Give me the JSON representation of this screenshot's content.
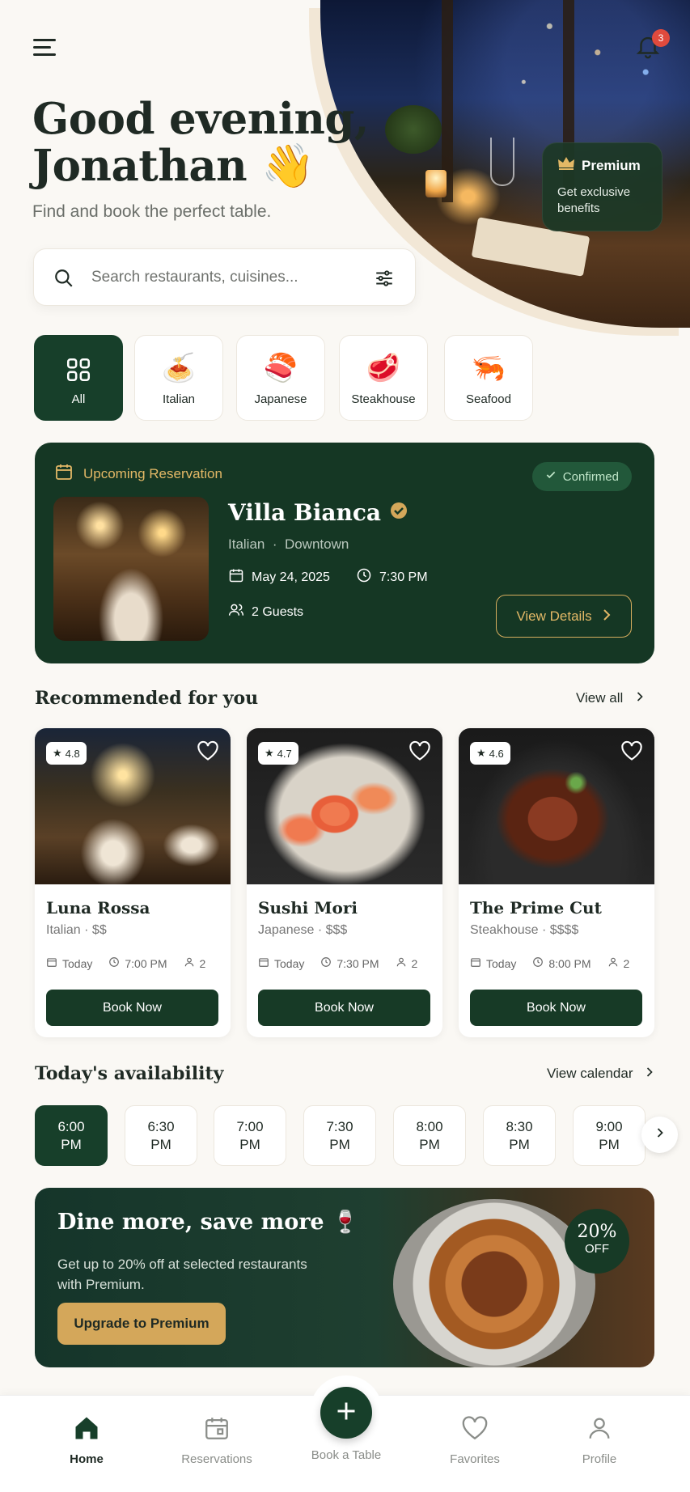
{
  "header": {
    "notification_count": "3",
    "greeting_line1": "Good evening,",
    "greeting_line2": "Jonathan 👋",
    "subtitle": "Find and book the perfect table."
  },
  "premium_card": {
    "title": "Premium",
    "desc": "Get exclusive benefits"
  },
  "search": {
    "placeholder": "Search restaurants, cuisines..."
  },
  "categories": [
    {
      "label": "All",
      "icon": "grid-icon"
    },
    {
      "label": "Italian",
      "icon": "🍝"
    },
    {
      "label": "Japanese",
      "icon": "🍣"
    },
    {
      "label": "Steakhouse",
      "icon": "🥩"
    },
    {
      "label": "Seafood",
      "icon": "🦐"
    }
  ],
  "reservation": {
    "heading": "Upcoming Reservation",
    "status": "Confirmed",
    "name": "Villa Bianca",
    "cuisine": "Italian",
    "area": "Downtown",
    "date": "May 24, 2025",
    "time": "7:30 PM",
    "guests": "2 Guests",
    "cta": "View Details"
  },
  "recommended": {
    "title": "Recommended for you",
    "link": "View all",
    "cards": [
      {
        "rating": "4.8",
        "name": "Luna Rossa",
        "cuisine": "Italian",
        "price": "$$",
        "day": "Today",
        "time": "7:00 PM",
        "guests": "2",
        "cta": "Book Now"
      },
      {
        "rating": "4.7",
        "name": "Sushi Mori",
        "cuisine": "Japanese",
        "price": "$$$",
        "day": "Today",
        "time": "7:30 PM",
        "guests": "2",
        "cta": "Book Now"
      },
      {
        "rating": "4.6",
        "name": "The Prime Cut",
        "cuisine": "Steakhouse",
        "price": "$$$$",
        "day": "Today",
        "time": "8:00 PM",
        "guests": "2",
        "cta": "Book Now"
      }
    ]
  },
  "availability": {
    "title": "Today's availability",
    "link": "View calendar",
    "slots": [
      {
        "t": "6:00",
        "p": "PM"
      },
      {
        "t": "6:30",
        "p": "PM"
      },
      {
        "t": "7:00",
        "p": "PM"
      },
      {
        "t": "7:30",
        "p": "PM"
      },
      {
        "t": "8:00",
        "p": "PM"
      },
      {
        "t": "8:30",
        "p": "PM"
      },
      {
        "t": "9:00",
        "p": "PM"
      }
    ]
  },
  "promo": {
    "title": "Dine more, save more 🍷",
    "desc": "Get up to 20% off at selected restaurants with Premium.",
    "cta": "Upgrade to Premium",
    "badge_pct": "20%",
    "badge_off": "OFF"
  },
  "nav": {
    "home": "Home",
    "reservations": "Reservations",
    "book": "Book a Table",
    "favorites": "Favorites",
    "profile": "Profile"
  },
  "colors": {
    "primary": "#173f2a",
    "accent": "#d4a75a",
    "background": "#faf8f4"
  }
}
